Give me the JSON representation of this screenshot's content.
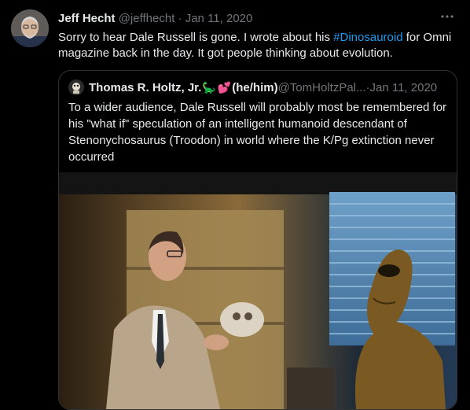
{
  "tweet": {
    "author_name": "Jeff Hecht",
    "handle": "@jeffhecht",
    "separator": "·",
    "date": "Jan 11, 2020",
    "more_icon": "more-horizontal-icon",
    "text_before": "Sorry to hear Dale Russell is gone. I wrote about his ",
    "hashtag": "#Dinosauroid",
    "text_after": " for Omni magazine back in the day. It got people thinking about evolution."
  },
  "quoted": {
    "author_name": "Thomas R. Holtz, Jr.",
    "emoji_1": "🦕",
    "emoji_2": "💕",
    "pronouns": "(he/him)",
    "handle": "@TomHoltzPal...",
    "separator": "·",
    "date": "Jan 11, 2020",
    "text": "To a wider audience, Dale Russell will probably most be remembered for his \"what if\" speculation of an intelligent humanoid descendant of Stenonychosaurus (Troodon) in world where the K/Pg extinction never occurred"
  },
  "colors": {
    "background": "#000000",
    "text": "#e7e9ea",
    "muted": "#71767b",
    "link": "#1d9bf0",
    "border": "#2f3336"
  }
}
